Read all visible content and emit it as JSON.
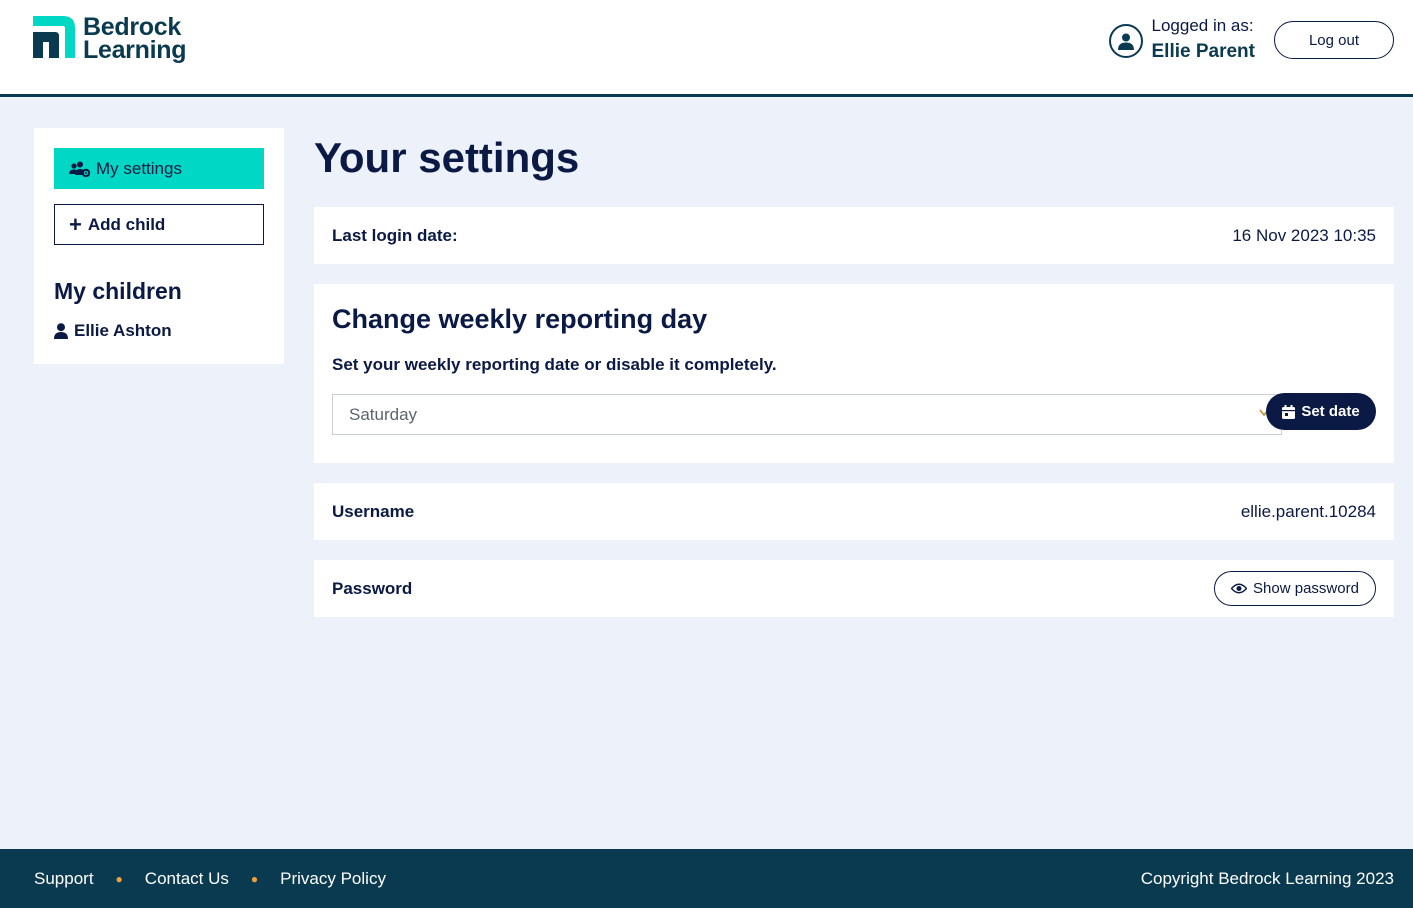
{
  "header": {
    "logo_line1": "Bedrock",
    "logo_line2": "Learning",
    "logged_in_label": "Logged in as:",
    "user_name": "Ellie Parent",
    "logout_label": "Log out"
  },
  "sidebar": {
    "my_settings_label": "My settings",
    "add_child_label": "Add child",
    "children_heading": "My children",
    "children": [
      {
        "name": "Ellie Ashton"
      }
    ]
  },
  "main": {
    "page_title": "Your settings",
    "last_login": {
      "label": "Last login date:",
      "value": "16 Nov 2023 10:35"
    },
    "weekly_report": {
      "title": "Change weekly reporting day",
      "description": "Set your weekly reporting date or disable it completely.",
      "selected_day": "Saturday",
      "set_date_label": "Set date"
    },
    "username": {
      "label": "Username",
      "value": "ellie.parent.10284"
    },
    "password": {
      "label": "Password",
      "show_label": "Show password"
    }
  },
  "footer": {
    "links": [
      "Support",
      "Contact Us",
      "Privacy Policy"
    ],
    "copyright": "Copyright Bedrock Learning 2023"
  },
  "colors": {
    "brand_dark": "#0a3a4f",
    "navy": "#0b1a44",
    "accent_teal": "#00d7c4",
    "background": "#edf1f9",
    "footer_dot": "#f0a23a"
  },
  "icons": [
    "logo-mark-icon",
    "user-circle-icon",
    "users-gear-icon",
    "plus-icon",
    "user-icon",
    "chevron-down-icon",
    "calendar-icon",
    "eye-icon"
  ]
}
